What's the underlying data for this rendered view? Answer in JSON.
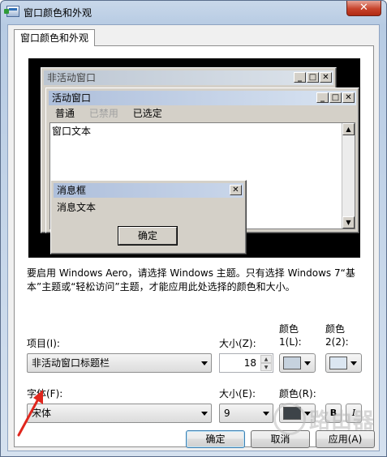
{
  "window": {
    "title": "窗口颜色和外观",
    "close_glyph": "✕"
  },
  "tab": {
    "label": "窗口颜色和外观"
  },
  "preview": {
    "inactive_window": {
      "title": "非活动窗口"
    },
    "active_window": {
      "title": "活动窗口",
      "menu": [
        "普通",
        "已禁用",
        "已选定"
      ],
      "text": "窗口文本"
    },
    "message_box": {
      "title": "消息框",
      "text": "消息文本",
      "ok_label": "确定"
    },
    "caption_glyphs": {
      "min": "_",
      "max": "□",
      "close": "✕"
    }
  },
  "description": "要启用 Windows Aero，请选择 Windows 主题。只有选择 Windows 7“基本”主题或“轻松访问”主题，才能应用此处选择的颜色和大小。",
  "item": {
    "label": "项目(I):",
    "value": "非活动窗口标题栏"
  },
  "item_size": {
    "label": "大小(Z):",
    "value": "18"
  },
  "color1": {
    "label_line1": "颜色",
    "label_line2": "1(L):",
    "color": "#c6d2de"
  },
  "color2": {
    "label_line1": "颜色",
    "label_line2": "2(2):",
    "color": "#dbe6f1"
  },
  "font": {
    "label": "字体(F):",
    "value": "宋体"
  },
  "font_size": {
    "label": "大小(E):",
    "value": "9"
  },
  "font_color": {
    "label": "颜色(R):",
    "color": "#3d4348"
  },
  "bold_label": "B",
  "italic_label": "I",
  "buttons": {
    "ok": "确定",
    "cancel": "取消",
    "apply": "应用(A)"
  },
  "watermark": {
    "text": "路由器"
  },
  "colors": {
    "annotation_arrow": "#e0261d",
    "accent": "#3c7fb1"
  }
}
